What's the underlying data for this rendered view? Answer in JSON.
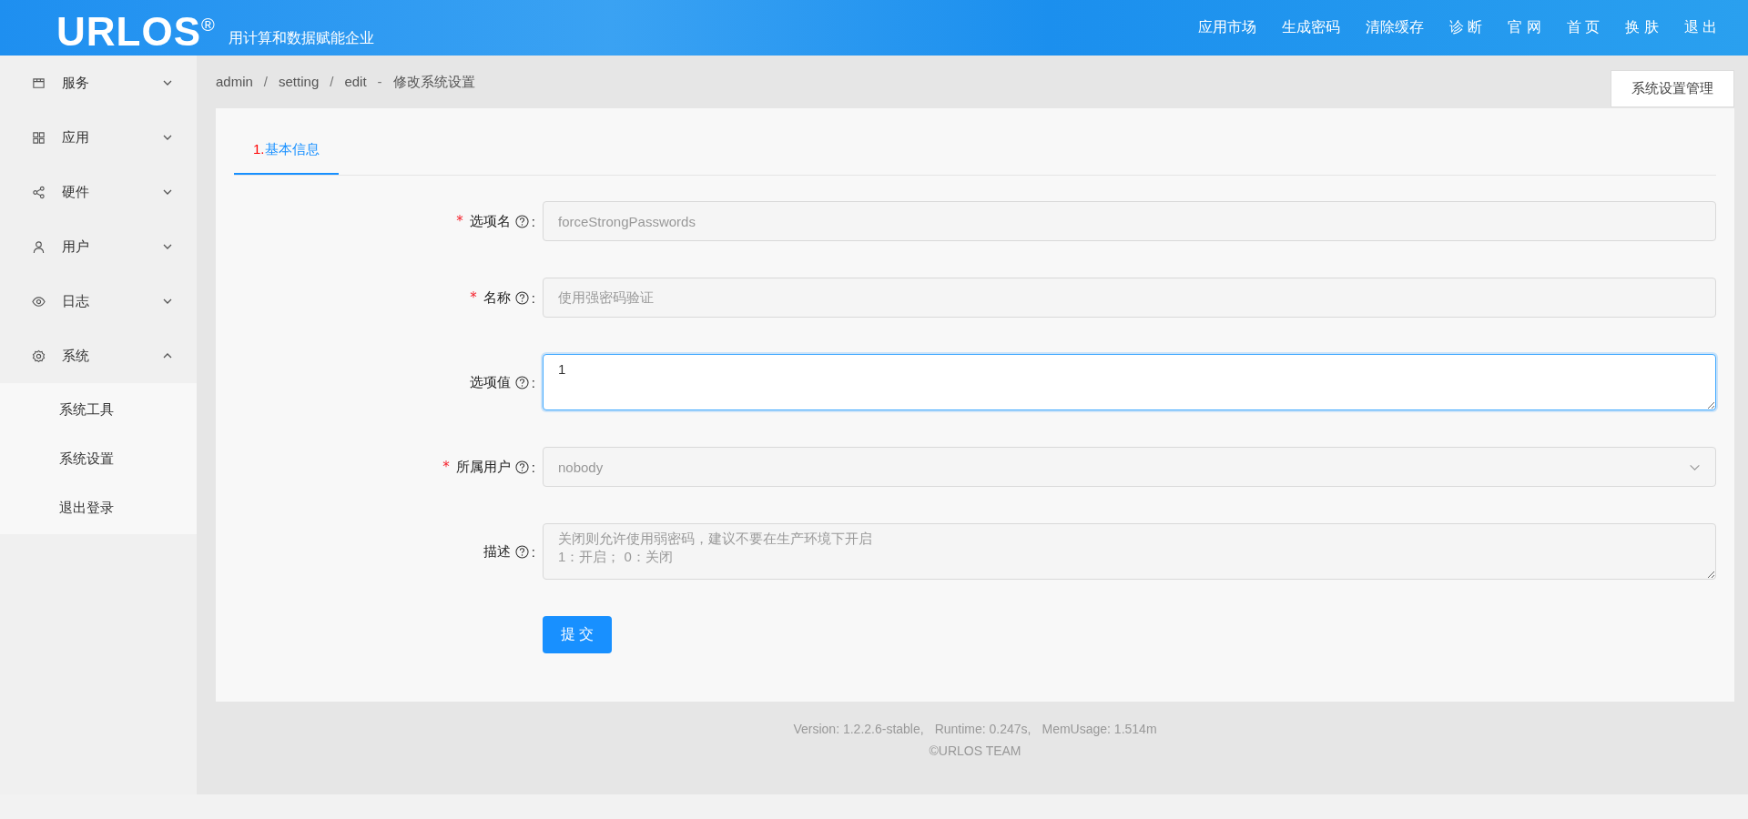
{
  "header": {
    "logo": "URLOS$^{®}$",
    "slogan": "用计算和数据赋能企业",
    "nav": [
      "应用市场",
      "生成密码",
      "清除缓存",
      "诊 断",
      "官 网",
      "首 页",
      "换 肤",
      "退 出"
    ]
  },
  "sidebar": {
    "items": [
      {
        "label": "服务",
        "expanded": false
      },
      {
        "label": "应用",
        "expanded": false
      },
      {
        "label": "硬件",
        "expanded": false
      },
      {
        "label": "用户",
        "expanded": false
      },
      {
        "label": "日志",
        "expanded": false
      },
      {
        "label": "系统",
        "expanded": true,
        "children": [
          {
            "label": "系统工具"
          },
          {
            "label": "系统设置"
          },
          {
            "label": "退出登录"
          }
        ]
      }
    ]
  },
  "breadcrumb": {
    "items": [
      "admin",
      "setting",
      "edit"
    ],
    "separator": "/",
    "dash": "-",
    "title": "修改系统设置"
  },
  "action_button": "系统设置管理",
  "tabs": [
    {
      "number": "1.",
      "label": "基本信息",
      "selected": true
    }
  ],
  "form": {
    "fields": [
      {
        "kind": "input",
        "required_mark": "*",
        "label": "选项名",
        "colon": ":",
        "disabled": true,
        "focused": false,
        "value": "forceStrongPasswords"
      },
      {
        "kind": "input",
        "required_mark": "*",
        "label": "名称",
        "colon": ":",
        "disabled": true,
        "focused": false,
        "value": "使用强密码验证"
      },
      {
        "kind": "textarea",
        "label": "选项值",
        "colon": ":",
        "disabled": false,
        "focused": true,
        "value": "1"
      },
      {
        "kind": "select",
        "required_mark": "*",
        "label": "所属用户",
        "colon": ":",
        "disabled": true,
        "focused": false,
        "value": "nobody"
      },
      {
        "kind": "textarea",
        "label": "描述",
        "colon": ":",
        "disabled": true,
        "focused": false,
        "value": "关闭则允许使用弱密码，建议不要在生产环境下开启\n1：开启； 0：关闭"
      }
    ],
    "submit": "提 交"
  },
  "footer": {
    "version": "Version: 1.2.2.6-stable,",
    "runtime": "Runtime: 0.247s,",
    "mem": "MemUsage: 1.514m",
    "copyright": "©URLOS TEAM"
  }
}
